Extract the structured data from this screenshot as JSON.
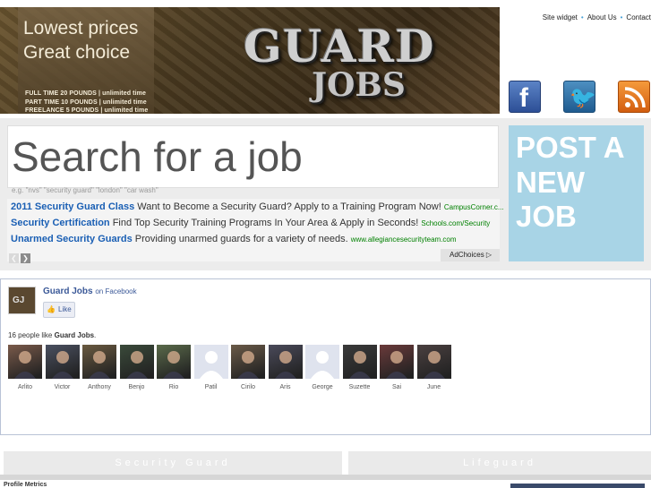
{
  "header": {
    "tagline_1": "Lowest prices",
    "tagline_2": "Great choice",
    "price_lines": [
      "FULL TIME   20 POUNDS  |  unlimited time",
      "PART TIME   10 POUNDS  |  unlimited time",
      "FREELANCE    5 POUNDS  |  unlimited time"
    ],
    "logo_main": "GUARD",
    "logo_sub": "JOBS",
    "nav": [
      "Site widget",
      "About Us",
      "Contact"
    ],
    "social_icons": [
      "facebook-icon",
      "twitter-icon",
      "rss-icon"
    ],
    "facebook_glyph": "f",
    "twitter_glyph": "🐦"
  },
  "search": {
    "placeholder": "Search for a job",
    "hint": "e.g. \"nvs\" \"security guard\" \"london\" \"car wash\""
  },
  "ads": [
    {
      "title": "2011 Security Guard Class",
      "text": "Want to Become a Security Guard? Apply to a Training Program Now!",
      "url": "CampusCorner.c..."
    },
    {
      "title": "Security Certification",
      "text": "Find Top Security Training Programs In Your Area & Apply in Seconds!",
      "url": "Schools.com/Security"
    },
    {
      "title": "Unarmed Security Guards",
      "text": "Providing unarmed guards for a variety of needs.",
      "url": "www.allegiancesecurityteam.com"
    }
  ],
  "ad_nav": {
    "prev": "❮",
    "next": "❯"
  },
  "adchoices": "AdChoices ▷",
  "post_job": {
    "line1": "POST A",
    "line2": "NEW",
    "line3": "JOB",
    "color": "#a8d4e6"
  },
  "facebook_box": {
    "page_name": "Guard Jobs",
    "on_label": "on Facebook",
    "like_label": "Like",
    "count_prefix": "16 people like ",
    "count_page": "Guard Jobs",
    "count_suffix": ".",
    "fans": [
      "Arlito",
      "Victor",
      "Anthony",
      "Benjo",
      "Rio",
      "Patil",
      "Cirilo",
      "Aris",
      "George",
      "Suzette",
      "Sai",
      "June"
    ]
  },
  "categories": [
    "Security Guard",
    "Lifeguard"
  ],
  "bottom_text": "Profile Metrics"
}
